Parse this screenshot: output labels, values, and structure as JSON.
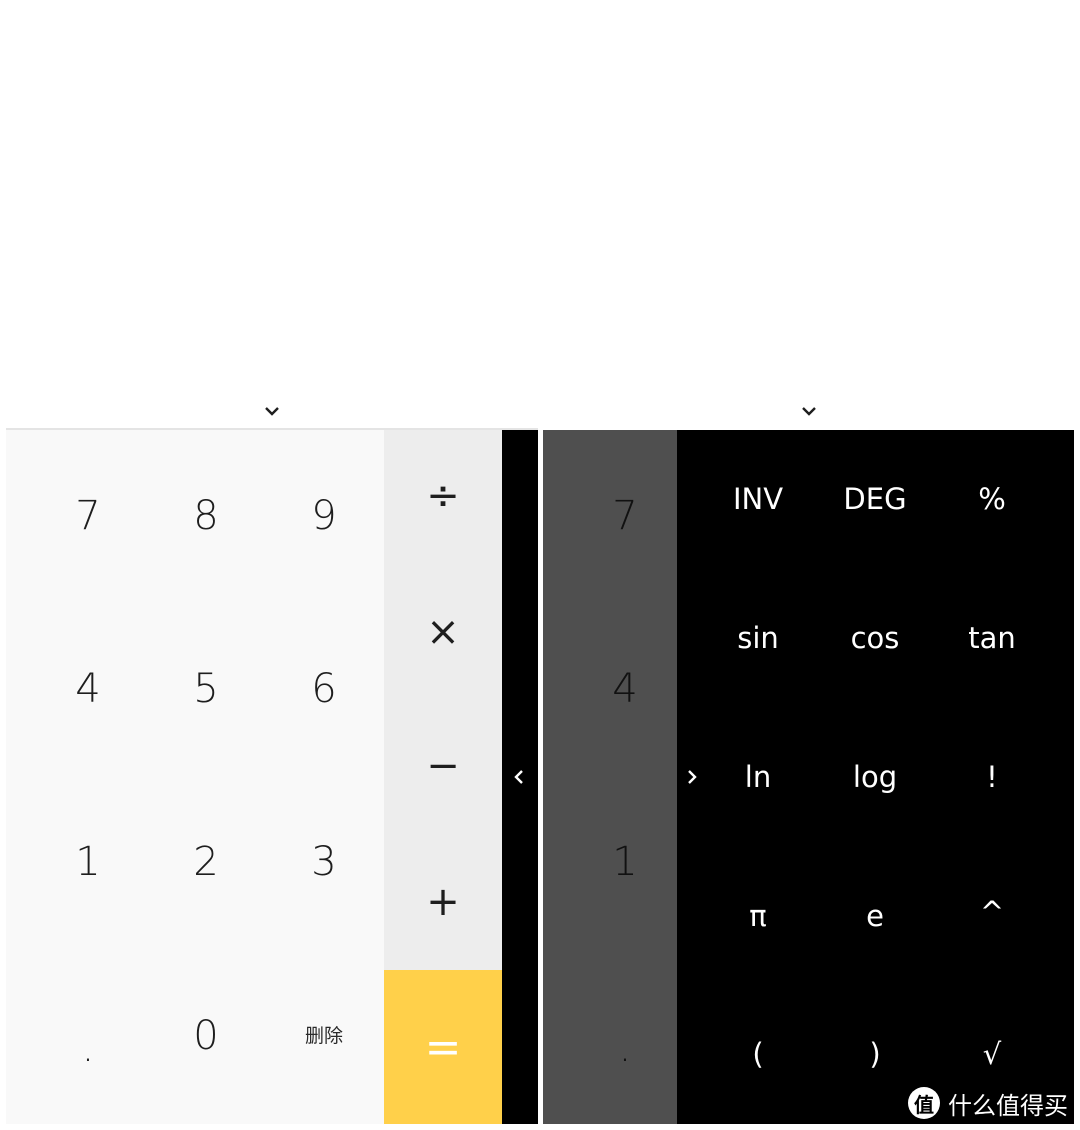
{
  "left_screen": {
    "display": {
      "collapse_icon": "chevron-down-icon"
    },
    "number_keys": [
      [
        "7",
        "8",
        "9"
      ],
      [
        "4",
        "5",
        "6"
      ],
      [
        "1",
        "2",
        "3"
      ],
      [
        ".",
        "0",
        "删除"
      ]
    ],
    "operator_keys": [
      "÷",
      "×",
      "−",
      "+"
    ],
    "equals_key": "=",
    "panel_toggle_icon": "chevron-left-icon",
    "colors": {
      "numpad_bg": "#f9f9f9",
      "operator_bg": "#ededed",
      "equals_bg": "#ffd04a",
      "strip_bg": "#000000"
    }
  },
  "right_screen": {
    "display": {
      "collapse_icon": "chevron-down-icon"
    },
    "visible_number_keys": [
      "7",
      "4",
      "1",
      "."
    ],
    "panel_toggle_icon": "chevron-right-icon",
    "advanced_keys": [
      [
        "INV",
        "DEG",
        "%"
      ],
      [
        "sin",
        "cos",
        "tan"
      ],
      [
        "ln",
        "log",
        "!"
      ],
      [
        "π",
        "e",
        "^"
      ],
      [
        "(",
        ")",
        "√"
      ]
    ],
    "colors": {
      "numpad_bg": "#4f4f4f",
      "advanced_bg": "#000000"
    }
  },
  "watermark": {
    "logo_char": "值",
    "text": "什么值得买"
  }
}
